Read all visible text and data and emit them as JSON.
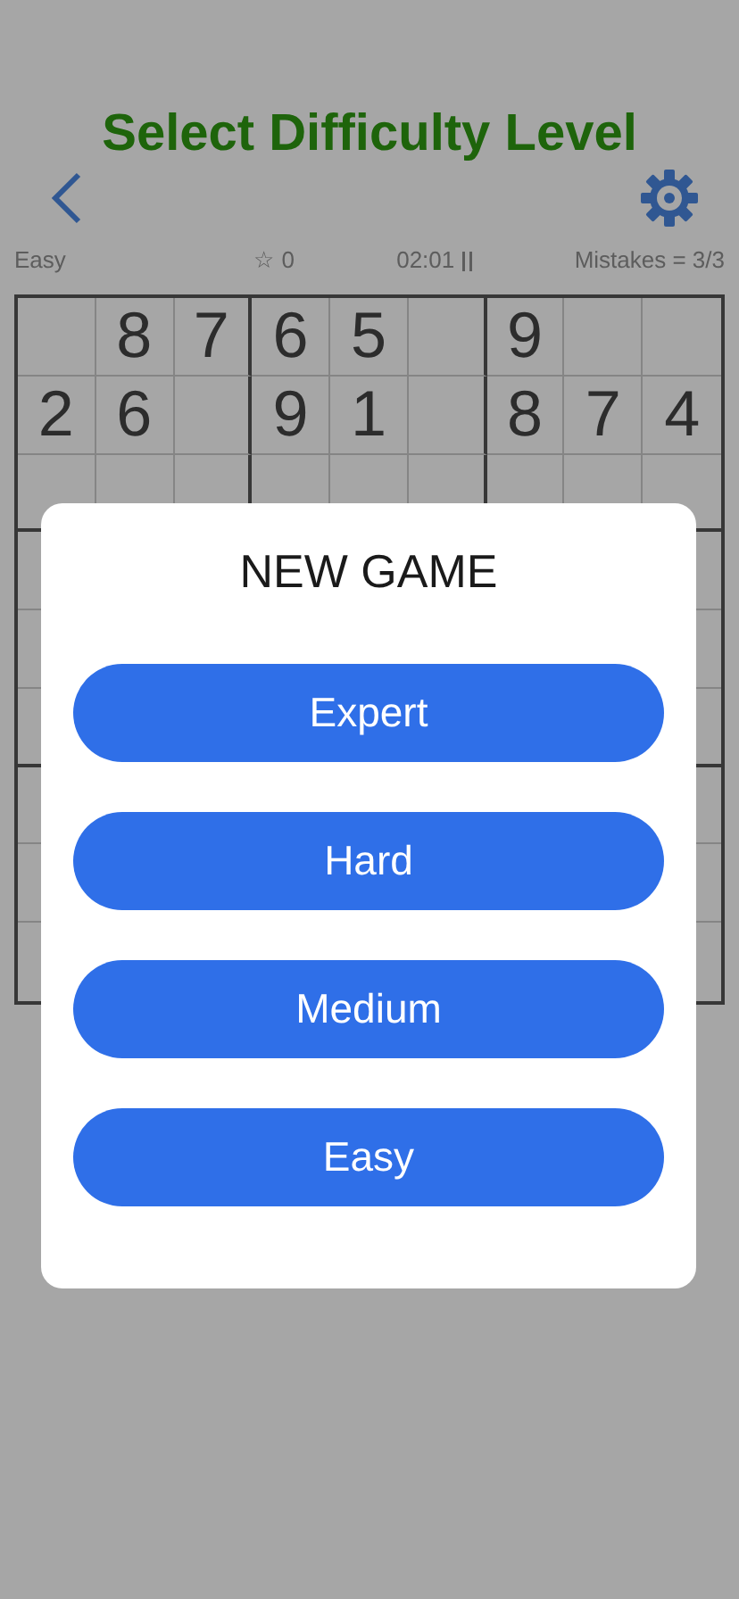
{
  "header": {
    "title": "Select Difficulty Level"
  },
  "status": {
    "difficulty": "Easy",
    "score": "☆ 0",
    "timer": "02:01",
    "mistakes": "Mistakes = 3/3"
  },
  "grid": {
    "rows": [
      [
        null,
        "8",
        "7",
        "6",
        "5",
        null,
        "9",
        null,
        null
      ],
      [
        "2",
        "6",
        null,
        "9",
        "1",
        null,
        "8",
        "7",
        "4"
      ]
    ]
  },
  "dialog": {
    "title": "NEW GAME",
    "options": [
      "Expert",
      "Hard",
      "Medium",
      "Easy"
    ]
  }
}
